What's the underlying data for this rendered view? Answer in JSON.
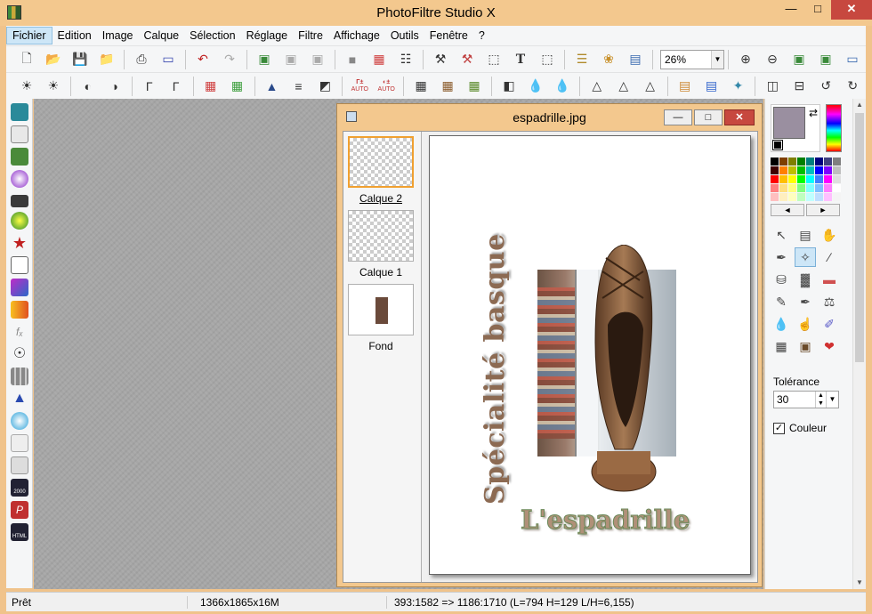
{
  "app": {
    "title": "PhotoFiltre Studio X"
  },
  "window_controls": {
    "minimize": "—",
    "maximize": "□",
    "close": "✕"
  },
  "menu": [
    {
      "label": "Fichier"
    },
    {
      "label": "Edition"
    },
    {
      "label": "Image"
    },
    {
      "label": "Calque"
    },
    {
      "label": "Sélection"
    },
    {
      "label": "Réglage"
    },
    {
      "label": "Filtre"
    },
    {
      "label": "Affichage"
    },
    {
      "label": "Outils"
    },
    {
      "label": "Fenêtre"
    },
    {
      "label": "?"
    }
  ],
  "toolbar": {
    "zoom_value": "26%",
    "auto_label": "AUTO",
    "text_tool_glyph": "T"
  },
  "document": {
    "title": "espadrille.jpg",
    "layers": [
      {
        "label": "Calque 2"
      },
      {
        "label": "Calque 1"
      },
      {
        "label": "Fond"
      }
    ],
    "canvas_text_vertical": "Spécialité basque",
    "canvas_text_bottom": "L'espadrille"
  },
  "right_panel": {
    "colors": {
      "foreground": "#9a8fa0",
      "background": "#ffffff"
    },
    "palette_prev": "◄",
    "palette_next": "►",
    "tolerance_label": "Tolérance",
    "tolerance_value": "30",
    "color_checkbox_label": "Couleur",
    "color_checkbox_checked": true
  },
  "status": {
    "state": "Prêt",
    "dimensions": "1366x1865x16M",
    "selection": "393:1582 => 1186:1710 (L=794  H=129  L/H=6,155)"
  }
}
